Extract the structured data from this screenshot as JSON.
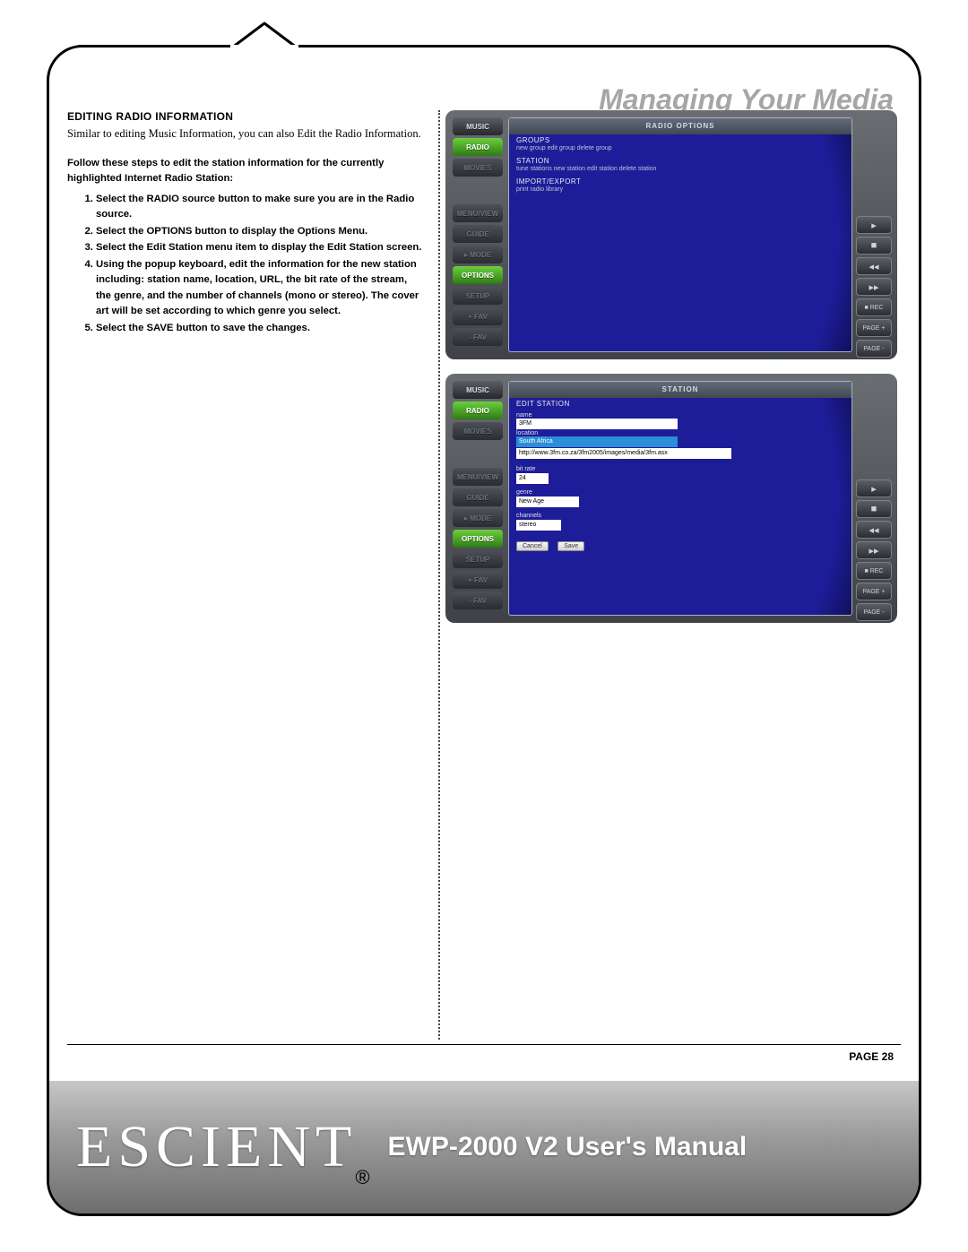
{
  "section_title": "Managing Your Media",
  "heading": "EDITING RADIO INFORMATION",
  "intro": "Similar to editing Music Information, you can also Edit the Radio Information.",
  "lead": "Follow these steps to edit the station information for the currently highlighted Internet Radio Station:",
  "steps": [
    "Select the RADIO source button to make sure you are in the Radio source.",
    "Select the OPTIONS button to display the Options Menu.",
    "Select the Edit Station menu item to display the Edit Station screen.",
    "Using the popup keyboard, edit the information for the new station including: station name, location, URL, the bit rate of the stream, the genre, and the number of channels (mono or stereo). The cover art will be set according to which genre you select.",
    "Select the SAVE button to save the changes."
  ],
  "nav_buttons": {
    "music": "MUSIC",
    "radio": "RADIO",
    "movies": "MOVIES",
    "menuview": "MENU/VIEW",
    "guide": "GUIDE",
    "mode": "▸ MODE",
    "options": "OPTIONS",
    "setup": "SETUP",
    "favplus": "+ FAV",
    "favminus": "- FAV"
  },
  "right_buttons": {
    "play": "▸",
    "stop": "■",
    "rew": "◂◂",
    "ff": "▸▸",
    "rec": "■ REC",
    "pageup": "PAGE +",
    "pagedown": "PAGE -"
  },
  "screen1": {
    "header": "RADIO OPTIONS",
    "sec1_label": "GROUPS",
    "sec1_sub": "new group  edit group  delete group",
    "sec2_label": "STATION",
    "sec2_sub": "tune stations  new station  edit station  delete station",
    "sec3_label": "IMPORT/EXPORT",
    "sec3_sub": "print radio library"
  },
  "screen2": {
    "header": "STATION",
    "title": "EDIT STATION",
    "name_label": "name",
    "name_value": "3FM",
    "loc_label": "location",
    "loc_value": "South Africa",
    "url_value": "http://www.3fm.co.za/3fm2005/images/media/3fm.asx",
    "bitrate_label": "bit rate",
    "bitrate_value": "24",
    "genre_label": "genre",
    "genre_value": "New Age",
    "channels_label": "channels",
    "channels_value": "stereo",
    "cancel": "Cancel",
    "save": "Save"
  },
  "page_label": "PAGE 28",
  "footer": {
    "logo": "ESCIENT",
    "reg": "®",
    "manual": "EWP-2000 V2 User's Manual"
  }
}
